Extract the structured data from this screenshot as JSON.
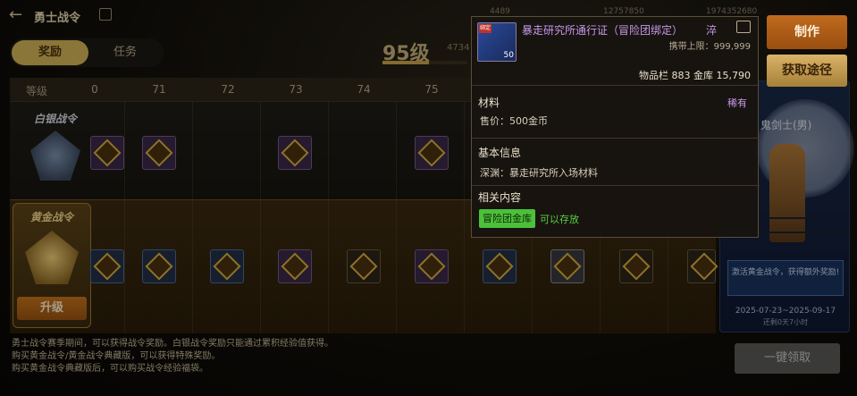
{
  "header": {
    "title": "勇士战令",
    "resources": [
      "4489",
      "12757850",
      "1974352680"
    ]
  },
  "tabs": [
    {
      "label": "奖励",
      "active": true
    },
    {
      "label": "任务",
      "active": false
    }
  ],
  "battle_pass": {
    "level_label": "95级",
    "exp_text": "4734",
    "level_progress": 0.55
  },
  "grid": {
    "header_label": "等级",
    "levels": [
      "0",
      "71",
      "72",
      "73",
      "74",
      "75"
    ],
    "silver_track": "白银战令",
    "gold_track": "黄金战令",
    "upgrade_label": "升级"
  },
  "description": [
    "勇士战令赛季期间，可以获得战令奖励。白银战令奖励只能通过累积经验值获得。",
    "购买黄金战令/黄金战令典藏版，可以获得特殊奖励。",
    "购买黄金战令典藏版后，可以购买战令经验福袋。"
  ],
  "side_panel": {
    "hero_name": "鬼剑士(男)",
    "promo_text": "激活黄金战令，获得额外奖励!",
    "date_range": "2025-07-23~2025-09-17",
    "remaining": "还剩0天7小时"
  },
  "claim_all_label": "一键领取",
  "actions": {
    "make_label": "制作",
    "source_label": "获取途径"
  },
  "tooltip": {
    "item_name": "暴走研究所通行证（冒险团绑定）",
    "item_name_extra": "淬",
    "icon_count": "50",
    "icon_tag": "绑定",
    "carry_limit": "携带上限：999,999",
    "stock": "物品栏 883 金库 15,790",
    "type_label": "材料",
    "rarity": "稀有",
    "sell_price": "售价：500金币",
    "basic_info_header": "基本信息",
    "basic_info": "深渊：暴走研究所入场材料",
    "related_header": "相关内容",
    "storage_tag": "冒险团金库",
    "storage_note": "可以存放"
  },
  "colors": {
    "rarity_purple": "#c59ae8",
    "storage_green": "#4cc03a",
    "gold_accent": "#d6b55a"
  }
}
